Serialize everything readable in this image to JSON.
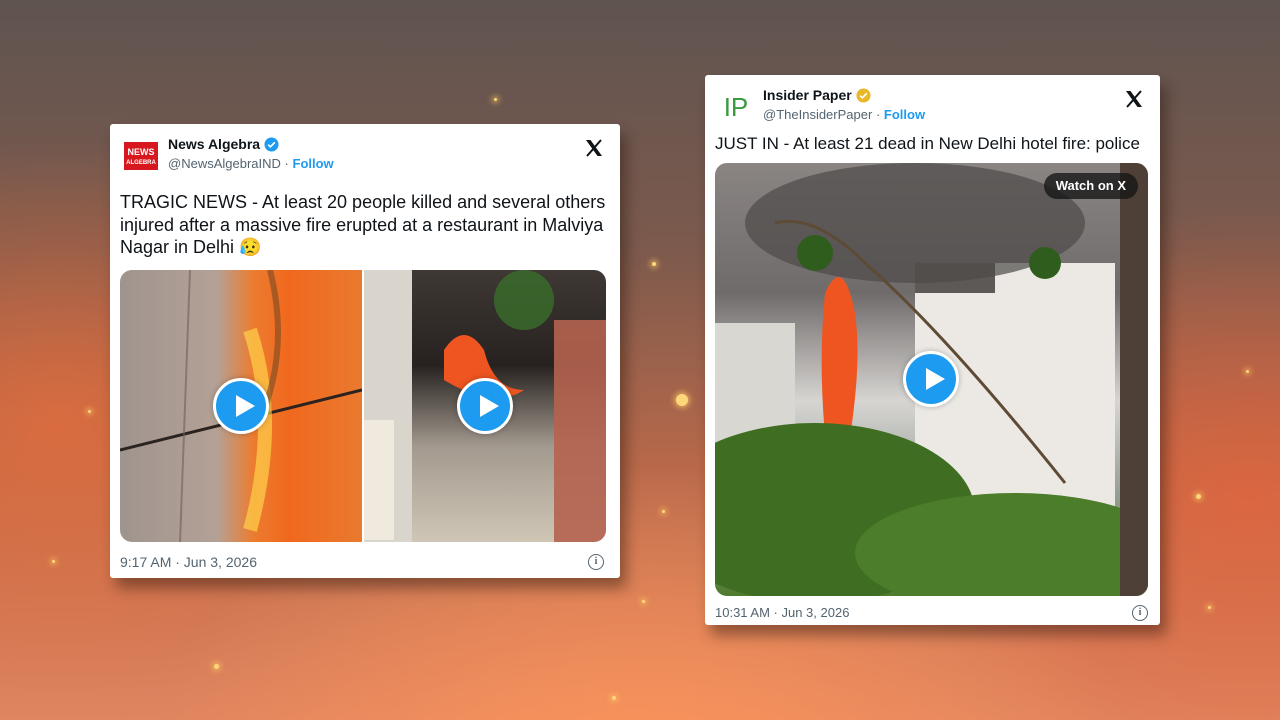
{
  "tweets": [
    {
      "avatar_text_top": "NEWS",
      "avatar_text_bottom": "ALGEBRA",
      "name": "News Algebra",
      "handle": "@NewsAlgebraIND",
      "separator": "·",
      "follow": "Follow",
      "text": "TRAGIC NEWS - At least 20 people killed and several others injured after a massive fire erupted at a restaurant in Malviya Nagar in Delhi 😥",
      "timestamp": "9:17 AM · Jun 3, 2026",
      "info": "i",
      "brand_color": "#d7191f"
    },
    {
      "avatar_text": "IP",
      "name": "Insider Paper",
      "handle": "@TheInsiderPaper",
      "separator": "·",
      "follow": "Follow",
      "text": "JUST IN - At least 21 dead in New Delhi hotel fire: police",
      "watch_label": "Watch on X",
      "timestamp": "10:31 AM · Jun 3, 2026",
      "info": "i",
      "brand_color": "#3a9b3e"
    }
  ],
  "colors": {
    "x_blue": "#1d9bf0",
    "verified_gold": "#e8b828",
    "text_primary": "#0f1419",
    "text_secondary": "#536471"
  },
  "icons": [
    "verified-badge-icon",
    "x-logo-icon",
    "play-icon",
    "info-icon"
  ]
}
